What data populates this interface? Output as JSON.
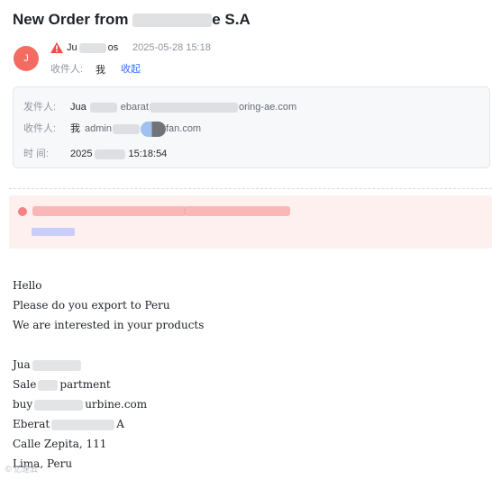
{
  "email": {
    "subject_prefix": "New Order from",
    "subject_visible_tail": "e S.A",
    "avatar_letter": "J",
    "sender_fragment_start": "Ju",
    "sender_fragment_end": "os",
    "date": "2025-05-28 15:18",
    "recipient_label": "收件人:",
    "recipient": "我",
    "collapse_label": "收起"
  },
  "details": {
    "from_label": "发件人:",
    "from_name_fragment": "Jua",
    "from_email_start": "ebarat",
    "from_email_end": "oring-ae.com",
    "to_label": "收件人:",
    "to_name": "我",
    "to_email_start": "admin",
    "to_email_end": "fan.com",
    "time_label": "时 间:",
    "time_start": "2025",
    "time_end": "15:18:54"
  },
  "body": {
    "lines": [
      "Hello",
      "Please do you export to Peru",
      "We are interested in your products"
    ],
    "sig_name": "Jua",
    "sig_title_start": "Sale",
    "sig_title_end": "partment",
    "sig_email_start": "buy",
    "sig_email_end": "urbine.com",
    "sig_company_start": "Eberat",
    "sig_company_end": "A",
    "sig_street": "Calle Zepita, 111",
    "sig_city": "Lima, Peru"
  },
  "watermark": "© 亿速云"
}
